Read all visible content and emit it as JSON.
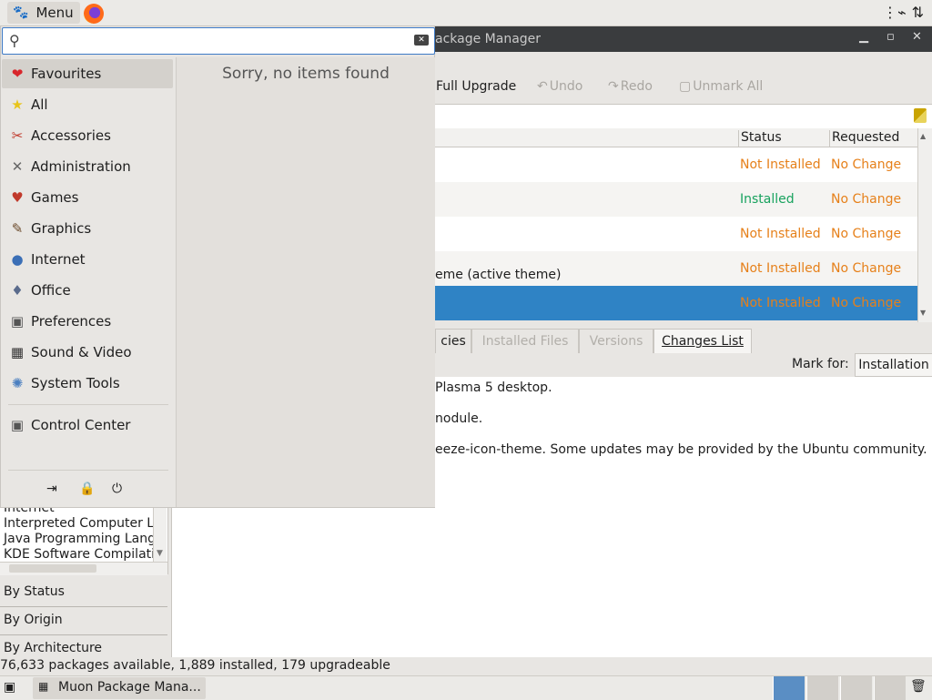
{
  "top_panel": {
    "menu_label": "Menu",
    "firefox_icon": "firefox-icon",
    "tray_icons": [
      "network-icon",
      "update-icon"
    ]
  },
  "window": {
    "title": "ackage Manager",
    "controls": [
      "minimize",
      "maximize",
      "close"
    ],
    "toolbar": {
      "full_upgrade": "Full Upgrade",
      "undo": "Undo",
      "redo": "Redo",
      "unmark_all": "Unmark All"
    },
    "columns": {
      "status": "Status",
      "requested": "Requested"
    },
    "rows": [
      {
        "name": "",
        "status": "Not Installed",
        "requested": "No Change"
      },
      {
        "name": "",
        "status": "Installed",
        "requested": "No Change"
      },
      {
        "name": "",
        "status": "Not Installed",
        "requested": "No Change"
      },
      {
        "name": "eme (active theme)",
        "status": "Not Installed",
        "requested": "No Change"
      },
      {
        "name": "",
        "status": "Not Installed",
        "requested": "No Change"
      }
    ],
    "tabs": [
      "cies",
      "Installed Files",
      "Versions",
      "Changes List"
    ],
    "mark_for_label": "Mark for:",
    "mark_for_value": "Installation",
    "details": [
      "Plasma 5 desktop.",
      "nodule.",
      "eeze-icon-theme. Some updates may be provided by the Ubuntu community."
    ],
    "left_list": [
      "Internet",
      "Interpreted Computer La",
      "Java Programming Lang",
      "KDE Software Compilati"
    ],
    "accordion": [
      "By Status",
      "By Origin",
      "By Architecture"
    ],
    "status_text": "76,633 packages available, 1,889 installed, 179 upgradeable"
  },
  "taskbar": {
    "task_label": "Muon Package Mana..."
  },
  "app_menu": {
    "search_value": "",
    "categories": [
      {
        "label": "Favourites",
        "icon": "heart-icon",
        "glyph": "❤",
        "color": "#d8262b"
      },
      {
        "label": "All",
        "icon": "star-icon",
        "glyph": "★",
        "color": "#e8c41a"
      },
      {
        "label": "Accessories",
        "icon": "accessories-icon",
        "glyph": "✂",
        "color": "#c0392b"
      },
      {
        "label": "Administration",
        "icon": "tools-icon",
        "glyph": "✕",
        "color": "#666666"
      },
      {
        "label": "Games",
        "icon": "cards-icon",
        "glyph": "♥",
        "color": "#c0392b"
      },
      {
        "label": "Graphics",
        "icon": "brush-icon",
        "glyph": "✎",
        "color": "#6b4a2a"
      },
      {
        "label": "Internet",
        "icon": "globe-icon",
        "glyph": "●",
        "color": "#3b6fb6"
      },
      {
        "label": "Office",
        "icon": "office-icon",
        "glyph": "♦",
        "color": "#5a6b8c"
      },
      {
        "label": "Preferences",
        "icon": "preferences-icon",
        "glyph": "▣",
        "color": "#555555"
      },
      {
        "label": "Sound & Video",
        "icon": "media-icon",
        "glyph": "▦",
        "color": "#333333"
      },
      {
        "label": "System Tools",
        "icon": "gear-icon",
        "glyph": "✺",
        "color": "#4a7fc0"
      },
      {
        "label": "Control Center",
        "icon": "control-center-icon",
        "glyph": "▣",
        "color": "#555555"
      }
    ],
    "empty_message": "Sorry, no items found"
  }
}
